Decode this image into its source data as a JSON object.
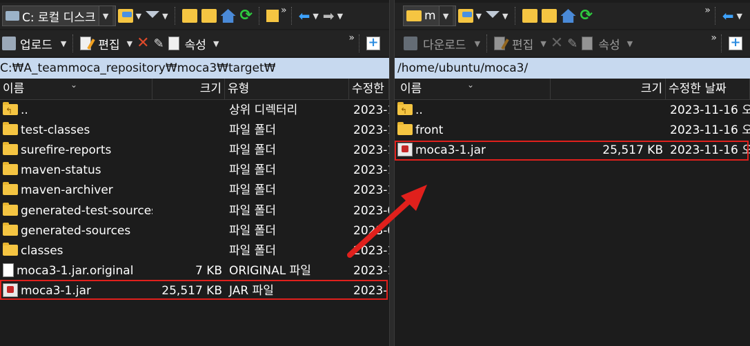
{
  "left": {
    "drive": {
      "label": "C: 로컬 디스크"
    },
    "toolbar2": {
      "upload_label": "업로드",
      "edit_label": "편집",
      "props_label": "속성"
    },
    "path": "C:₩A_teammoca_repository₩moca3₩target₩",
    "columns": {
      "name": "이름",
      "size": "크기",
      "type": "유형",
      "modified": "수정한"
    },
    "rows": [
      {
        "name": "..",
        "size": "",
        "type": "상위 디렉터리",
        "modified": "2023-1",
        "icon": "folder-up-icon"
      },
      {
        "name": "test-classes",
        "size": "",
        "type": "파일 폴더",
        "modified": "2023-1",
        "icon": "folder-icon"
      },
      {
        "name": "surefire-reports",
        "size": "",
        "type": "파일 폴더",
        "modified": "2023-1",
        "icon": "folder-icon"
      },
      {
        "name": "maven-status",
        "size": "",
        "type": "파일 폴더",
        "modified": "2023-1",
        "icon": "folder-icon"
      },
      {
        "name": "maven-archiver",
        "size": "",
        "type": "파일 폴더",
        "modified": "2023-1",
        "icon": "folder-icon"
      },
      {
        "name": "generated-test-sources",
        "size": "",
        "type": "파일 폴더",
        "modified": "2023-0",
        "icon": "folder-icon"
      },
      {
        "name": "generated-sources",
        "size": "",
        "type": "파일 폴더",
        "modified": "2023-0",
        "icon": "folder-icon"
      },
      {
        "name": "classes",
        "size": "",
        "type": "파일 폴더",
        "modified": "2023-1",
        "icon": "folder-icon"
      },
      {
        "name": "moca3-1.jar.original",
        "size": "7 KB",
        "type": "ORIGINAL 파일",
        "modified": "2023-1",
        "icon": "file-icon"
      },
      {
        "name": "moca3-1.jar",
        "size": "25,517 KB",
        "type": "JAR 파일",
        "modified": "2023-",
        "icon": "jar-file-icon"
      }
    ]
  },
  "right": {
    "drive": {
      "label": "m"
    },
    "toolbar2": {
      "download_label": "다운로드",
      "edit_label": "편집",
      "props_label": "속성"
    },
    "path": "/home/ubuntu/moca3/",
    "columns": {
      "name": "이름",
      "size": "크기",
      "modified": "수정한 날짜"
    },
    "rows": [
      {
        "name": "..",
        "size": "",
        "modified": "2023-11-16 오",
        "icon": "folder-up-icon"
      },
      {
        "name": "front",
        "size": "",
        "modified": "2023-11-16 오",
        "icon": "folder-icon"
      },
      {
        "name": "moca3-1.jar",
        "size": "25,517 KB",
        "modified": "2023-11-16 오",
        "icon": "jar-file-icon"
      }
    ]
  },
  "colors": {
    "highlight": "#e0201c",
    "path_bar": "#c7d9ef",
    "background": "#1c1c1c"
  },
  "overflow_marker": "»"
}
